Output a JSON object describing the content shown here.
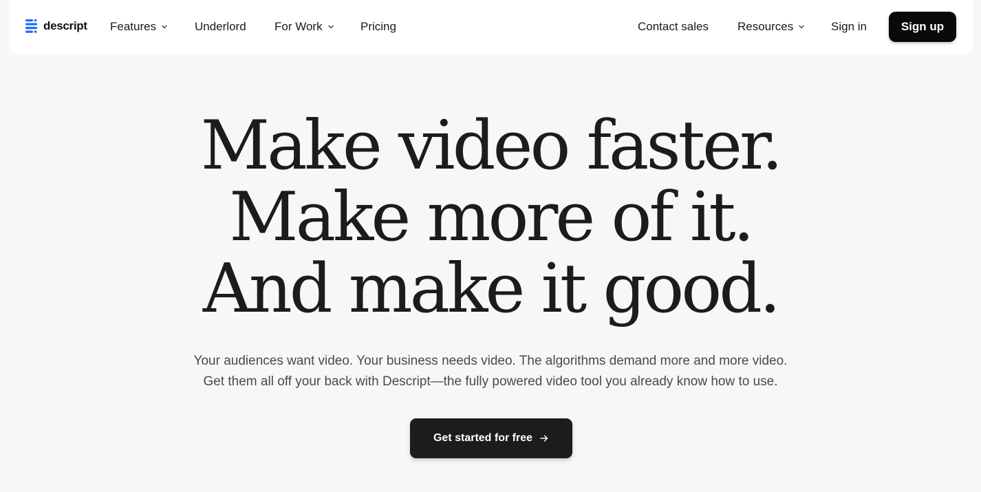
{
  "nav": {
    "logo_text": "descript",
    "items_left": [
      {
        "label": "Features",
        "dropdown": true
      },
      {
        "label": "Underlord",
        "dropdown": false
      },
      {
        "label": "For Work",
        "dropdown": true
      },
      {
        "label": "Pricing",
        "dropdown": false
      }
    ],
    "items_right": [
      {
        "label": "Contact sales",
        "dropdown": false
      },
      {
        "label": "Resources",
        "dropdown": true
      },
      {
        "label": "Sign in",
        "dropdown": false
      }
    ],
    "signup_label": "Sign up"
  },
  "hero": {
    "lines": [
      "Make video faster.",
      "Make more of it.",
      "And make it good."
    ],
    "subtitle_lines": [
      "Your audiences want video. Your business needs video. The algorithms demand more and more video.",
      "Get them all off your back with Descript—the fully powered video tool you already know how to use."
    ],
    "cta_label": "Get started for free"
  },
  "icons": {
    "logo": "descript-logo-icon",
    "dropdown": "chevron-down-icon",
    "cta": "arrow-right-icon"
  },
  "colors": {
    "background": "#f8f7f5",
    "nav_bg": "#ffffff",
    "button_dark": "#0a0a0a",
    "logo_blue": "#1f6bff",
    "text": "#1a1a1a",
    "subtitle": "#4a4a4a"
  }
}
